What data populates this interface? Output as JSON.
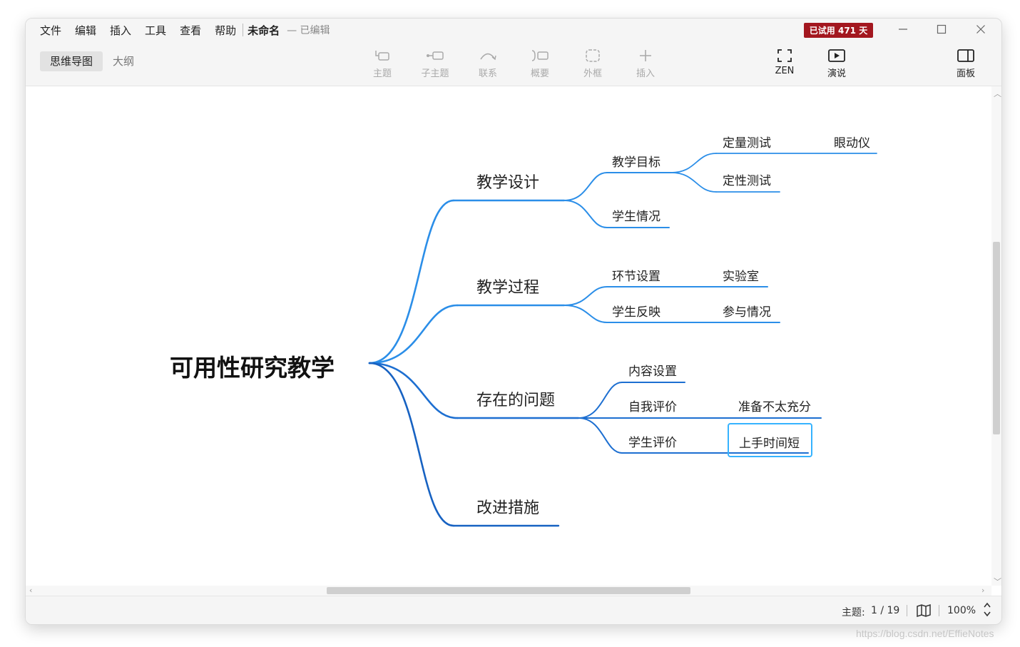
{
  "menu": {
    "items": [
      "文件",
      "编辑",
      "插入",
      "工具",
      "查看",
      "帮助"
    ],
    "doc_title": "未命名",
    "doc_status": "— 已编辑"
  },
  "trial_badge": "已试用 471 天",
  "view_tabs": [
    "思维导图",
    "大纲"
  ],
  "toolbar": {
    "topic": "主题",
    "subtopic": "子主题",
    "relationship": "联系",
    "summary": "概要",
    "boundary": "外框",
    "insert": "插入",
    "zen": "ZEN",
    "present": "演说",
    "panel": "面板"
  },
  "mindmap": {
    "root": "可用性研究教学",
    "branches": [
      {
        "label": "教学设计",
        "children": [
          {
            "label": "教学目标",
            "children": [
              {
                "label": "定量测试",
                "children": [
                  {
                    "label": "眼动仪"
                  }
                ]
              },
              {
                "label": "定性测试"
              }
            ]
          },
          {
            "label": "学生情况"
          }
        ]
      },
      {
        "label": "教学过程",
        "children": [
          {
            "label": "环节设置",
            "children": [
              {
                "label": "实验室"
              }
            ]
          },
          {
            "label": "学生反映",
            "children": [
              {
                "label": "参与情况"
              }
            ]
          }
        ]
      },
      {
        "label": "存在的问题",
        "children": [
          {
            "label": "内容设置"
          },
          {
            "label": "自我评价",
            "children": [
              {
                "label": "准备不太充分"
              }
            ]
          },
          {
            "label": "学生评价",
            "children": [
              {
                "label": "上手时间短"
              }
            ]
          }
        ]
      },
      {
        "label": "改进措施"
      }
    ],
    "selected_topic": "上手时间短"
  },
  "status": {
    "topic_count_label": "主题:",
    "topic_count_value": "1 / 19",
    "zoom": "100%"
  },
  "watermark": "https://blog.csdn.net/EffieNotes",
  "colors": {
    "branch_1": "#2b8ee8",
    "branch_2": "#2b8ee8",
    "branch_3": "#1d6fd1",
    "branch_4": "#1762c2",
    "selection": "#36b3ff",
    "trial_badge": "#a3171f"
  }
}
